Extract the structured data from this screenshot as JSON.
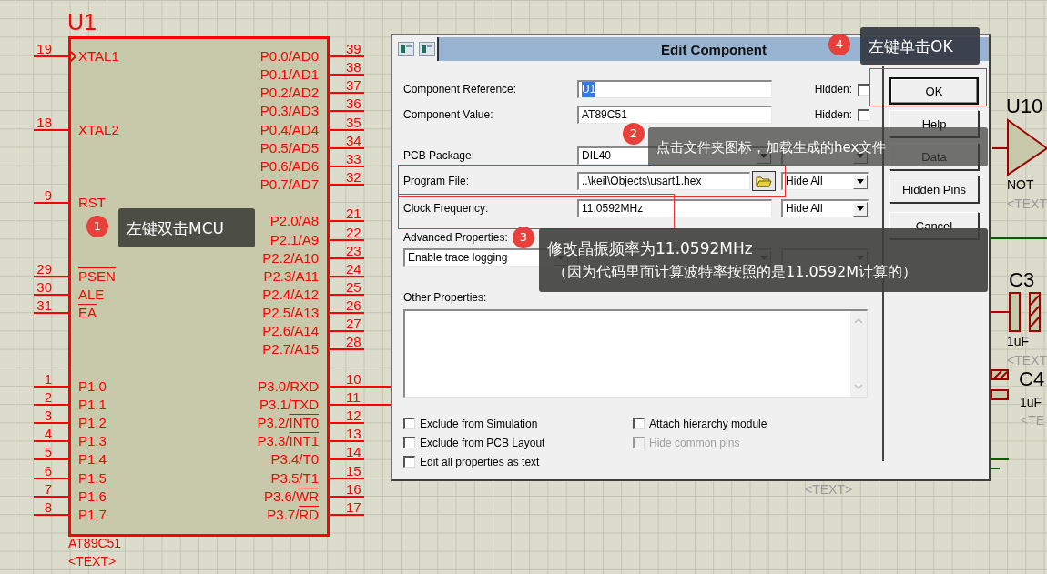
{
  "schematic": {
    "chip": {
      "ref": "U1",
      "value": "AT89C51",
      "text": "<TEXT>",
      "left_groups": [
        [
          {
            "kind": "clock",
            "number": "19",
            "label": "XTAL1"
          }
        ],
        [
          {
            "kind": "plain",
            "number": "18",
            "label": "XTAL2"
          }
        ],
        [
          {
            "kind": "plain",
            "number": "9",
            "label": "RST"
          }
        ],
        [
          {
            "kind": "plain",
            "number": "29",
            "overbar": "PSEN"
          },
          {
            "kind": "plain",
            "number": "30",
            "label": "ALE"
          },
          {
            "kind": "plain",
            "number": "31",
            "overbar": "EA"
          }
        ],
        [
          {
            "kind": "plain",
            "number": "1",
            "label": "P1.0"
          },
          {
            "kind": "plain",
            "number": "2",
            "label": "P1.1"
          },
          {
            "kind": "plain",
            "number": "3",
            "label": "P1.2"
          },
          {
            "kind": "plain",
            "number": "4",
            "label": "P1.3"
          },
          {
            "kind": "plain",
            "number": "5",
            "label": "P1.4"
          },
          {
            "kind": "plain",
            "number": "6",
            "label": "P1.5"
          },
          {
            "kind": "plain",
            "number": "7",
            "label": "P1.6"
          },
          {
            "kind": "plain",
            "number": "8",
            "label": "P1.7"
          }
        ]
      ],
      "right_groups": [
        [
          {
            "number": "39",
            "label": "P0.0/AD0"
          },
          {
            "number": "38",
            "label": "P0.1/AD1"
          },
          {
            "number": "37",
            "label": "P0.2/AD2"
          },
          {
            "number": "36",
            "label": "P0.3/AD3"
          },
          {
            "number": "35",
            "label": "P0.4/AD4"
          },
          {
            "number": "34",
            "label": "P0.5/AD5"
          },
          {
            "number": "33",
            "label": "P0.6/AD6"
          },
          {
            "number": "32",
            "label": "P0.7/AD7"
          }
        ],
        [
          {
            "number": "21",
            "label": "P2.0/A8"
          },
          {
            "number": "22",
            "label": "P2.1/A9"
          },
          {
            "number": "23",
            "label": "P2.2/A10"
          },
          {
            "number": "24",
            "label": "P2.3/A11"
          },
          {
            "number": "25",
            "label": "P2.4/A12"
          },
          {
            "number": "26",
            "label": "P2.5/A13"
          },
          {
            "number": "27",
            "label": "P2.6/A14"
          },
          {
            "number": "28",
            "label": "P2.7/A15"
          }
        ],
        [
          {
            "number": "10",
            "label": "P3.0/RXD"
          },
          {
            "number": "11",
            "label": "P3.1/TXD"
          },
          {
            "number": "12",
            "label": "P3.2/",
            "overbar": "INT0"
          },
          {
            "number": "13",
            "label": "P3.3/",
            "overbar": "INT1"
          },
          {
            "number": "14",
            "label": "P3.4/T0"
          },
          {
            "number": "15",
            "label": "P3.5/T1"
          },
          {
            "number": "16",
            "label": "P3.6/",
            "overbar": "WR"
          },
          {
            "number": "17",
            "label": "P3.7/",
            "overbar": "RD"
          }
        ]
      ]
    },
    "parts": [
      {
        "kind": "not_gate",
        "ref": "U10",
        "value": "NOT",
        "text": "<TEXT"
      },
      {
        "kind": "capacitor",
        "ref": "C3",
        "value": "1uF",
        "text": "<TEXT"
      },
      {
        "kind": "capacitor_side",
        "ref": "C4",
        "value": "1uF",
        "text": "<TE"
      }
    ],
    "loose_text": "<TEXT>"
  },
  "dialog": {
    "title": "Edit Component",
    "fields": [
      {
        "kind": "text",
        "label": "Component Reference:",
        "value": "U1",
        "value_selected": true,
        "hidden_label": "Hidden:",
        "hidden": false
      },
      {
        "kind": "text",
        "label": "Component Value:",
        "value": "AT89C51",
        "value_selected": false,
        "hidden_label": "Hidden:",
        "hidden": false
      },
      {
        "kind": "select",
        "label": "PCB Package:",
        "value": "DIL40"
      },
      {
        "kind": "file",
        "label": "Program File:",
        "value": "..\\keil\\Objects\\usart1.hex",
        "visibility": "Hide All"
      },
      {
        "kind": "visibility",
        "label": "Clock Frequency:",
        "value": "11.0592MHz",
        "visibility": "Hide All"
      }
    ],
    "advanced": {
      "label": "Advanced Properties:",
      "property": "Enable trace logging"
    },
    "other_label": "Other Properties:",
    "options_left": [
      {
        "label": "Exclude from Simulation",
        "checked": false,
        "disabled": false
      },
      {
        "label": "Exclude from PCB Layout",
        "checked": false,
        "disabled": false
      },
      {
        "label": "Edit all properties as text",
        "checked": false,
        "disabled": false
      }
    ],
    "options_right": [
      {
        "label": "Attach hierarchy module",
        "checked": false,
        "disabled": false
      },
      {
        "label": "Hide common pins",
        "checked": false,
        "disabled": true
      }
    ],
    "buttons": [
      {
        "label": "OK",
        "default": true
      },
      {
        "label": "Help",
        "default": false
      },
      {
        "label": "Data",
        "default": false
      },
      {
        "label": "Hidden Pins",
        "default": false
      },
      {
        "label": "Cancel",
        "default": false
      }
    ]
  },
  "callouts": [
    {
      "number": "1",
      "lines": [
        "左键双击MCU"
      ]
    },
    {
      "number": "2",
      "lines": [
        "点击文件夹图标，加载生成的hex文件"
      ]
    },
    {
      "number": "3",
      "lines": [
        "修改晶振频率为11.0592MHz",
        "（因为代码里面计算波特率按照的是11.0592M计算的）"
      ]
    },
    {
      "number": "4",
      "lines": [
        "左键单击OK"
      ]
    }
  ]
}
